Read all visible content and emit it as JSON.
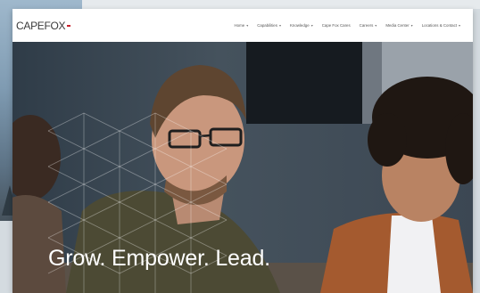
{
  "logo": {
    "text": "CAPEFOX",
    "badge": ""
  },
  "nav": {
    "items": [
      {
        "label": "Home",
        "chev": "▾"
      },
      {
        "label": "Capabilities",
        "chev": "▾"
      },
      {
        "label": "Knowledge",
        "chev": "▾"
      },
      {
        "label": "Cape Fox Cares",
        "chev": ""
      },
      {
        "label": "Careers",
        "chev": "▾"
      },
      {
        "label": "Media Center",
        "chev": "▾"
      },
      {
        "label": "Locations & Contact",
        "chev": "▾"
      }
    ]
  },
  "hero": {
    "headline": "Grow. Empower. Lead.",
    "subline": ""
  }
}
